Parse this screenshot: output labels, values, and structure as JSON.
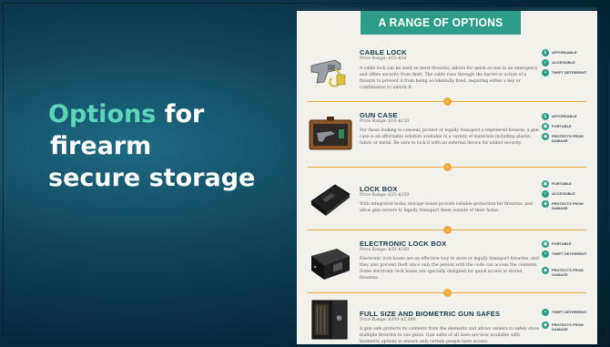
{
  "slide": {
    "title_accent": "Options",
    "title_rest_1": " for",
    "title_line2": "firearm",
    "title_line3": "secure storage"
  },
  "panel": {
    "banner": "A RANGE OF OPTIONS",
    "items": [
      {
        "name": "CABLE LOCK",
        "price": "Price Range: $15–$50",
        "description": "A cable lock can be used on most firearms, allows for quick access in an emergency and offers security from theft. The cable runs through the barrel or action of a firearm to prevent it from being accidentally fired, requiring either a key or combination to unlock it.",
        "features": [
          "Affordable",
          "Accessible",
          "Theft deterrent"
        ],
        "icon": "cable-lock"
      },
      {
        "name": "GUN CASE",
        "price": "Price Range: $10–$150",
        "description": "For those looking to conceal, protect or legally transport a registered firearm, a gun case is an affordable solution available in a variety of materials including plastic, fabric or metal. Be sure to lock it with an external device for added security.",
        "features": [
          "Affordable",
          "Portable",
          "Protects from damage"
        ],
        "icon": "gun-case"
      },
      {
        "name": "LOCK BOX",
        "price": "Price Range: $25–$350",
        "description": "With integrated locks, storage boxes provide reliable protection for firearms, and allow gun owners to legally transport them outside of their home.",
        "features": [
          "Portable",
          "Accessible",
          "Protects from damage"
        ],
        "icon": "lock-box"
      },
      {
        "name": "ELECTRONIC LOCK BOX",
        "price": "Price Range: $50–$300",
        "description": "Electronic lock boxes are an effective way to store or legally transport firearms, and they also prevent theft since only the person with the code can access the contents. Some electronic lock boxes are specially designed for quick access to stored firearms.",
        "features": [
          "Portable",
          "Theft deterrent",
          "Protects from damage"
        ],
        "icon": "electronic-lock-box"
      },
      {
        "name": "FULL SIZE AND BIOMETRIC GUN SAFES",
        "price": "Price Range: $200–$2,000",
        "description": "A gun safe protects its contents from the elements and allows owners to safely store multiple firearms in one place. Gun safes of all sizes are now available with biometric options to ensure only certain people have access.",
        "features": [
          "Theft deterrent",
          "Protects from damage"
        ],
        "icon": "gun-safe"
      }
    ]
  },
  "colors": {
    "accent": "#5ed4b8",
    "teal": "#2d9c89",
    "orange": "#f2a93b",
    "navy": "#17384a"
  }
}
